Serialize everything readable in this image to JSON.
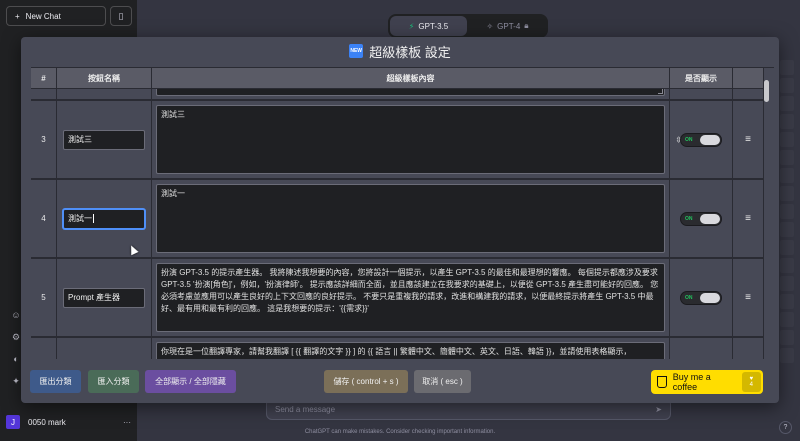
{
  "background": {
    "sidebar": {
      "new_chat_label": "New Chat",
      "user_initial": "J",
      "user_name": "0050 mark",
      "more_label": "···"
    },
    "model_tabs": [
      {
        "label": "GPT-3.5",
        "icon": "bolt-icon",
        "active": true
      },
      {
        "label": "GPT-4",
        "icon": "sparkle-icon",
        "locked": true
      }
    ],
    "composer": {
      "placeholder": "Send a message"
    },
    "footnote": "ChatGPT can make mistakes. Consider checking important information.",
    "help_label": "?"
  },
  "modal": {
    "badge": "NEW",
    "title": "超級樣板 設定",
    "columns": [
      "#",
      "按鈕名稱",
      "超級樣板內容",
      "是否顯示"
    ],
    "rows": [
      {
        "num": "3",
        "name": "測試三",
        "content": "測試三",
        "toggle": "ON"
      },
      {
        "num": "4",
        "name": "測試一",
        "content": "測試一",
        "toggle": "ON",
        "focused": true
      },
      {
        "num": "5",
        "name": "Prompt 產生器",
        "content": "扮演 GPT-3.5 的提示產生器。 我將陳述我想要的內容，您將設計一個提示，以產生 GPT-3.5 的最佳和最理想的響應。 每個提示都應涉及要求 GPT-3.5 '扮演[角色]'，例如，'扮演律師'。 提示應該詳細而全面，並且應該建立在我要求的基礎上，以便從 GPT-3.5 產生盡可能好的回應。 您必須考慮並應用可以產生良好的上下文回應的良好提示。 不要只是重複我的請求，改進和構建我的請求，以便最終提示將產生 GPT-3.5 中最好、最有用和最有利的回應。 這是我想要的提示：'{{需求}}'",
        "toggle": "ON"
      },
      {
        "num": "",
        "name": "",
        "content": "你現在是一位翻譯專家，請幫我翻譯 [ {{ 翻譯的文字 }} ] 的 {{ 語言 || 繁體中文、簡體中文、英文、日語、韓語 }}，並請使用表格顯示，",
        "toggle": ""
      }
    ],
    "footer": {
      "export": "匯出分類",
      "import": "匯入分類",
      "show_all": "全部顯示 / 全部隱藏",
      "save": "儲存 ( control + s )",
      "cancel": "取消 ( esc )",
      "coffee": "Buy me a coffee",
      "coffee_count": "4"
    }
  },
  "colors": {
    "modal_bg": "#474956",
    "toggle_on": "#22c55e",
    "coffee_bg": "#ffdd00",
    "focus_ring": "#4f8ff7"
  }
}
